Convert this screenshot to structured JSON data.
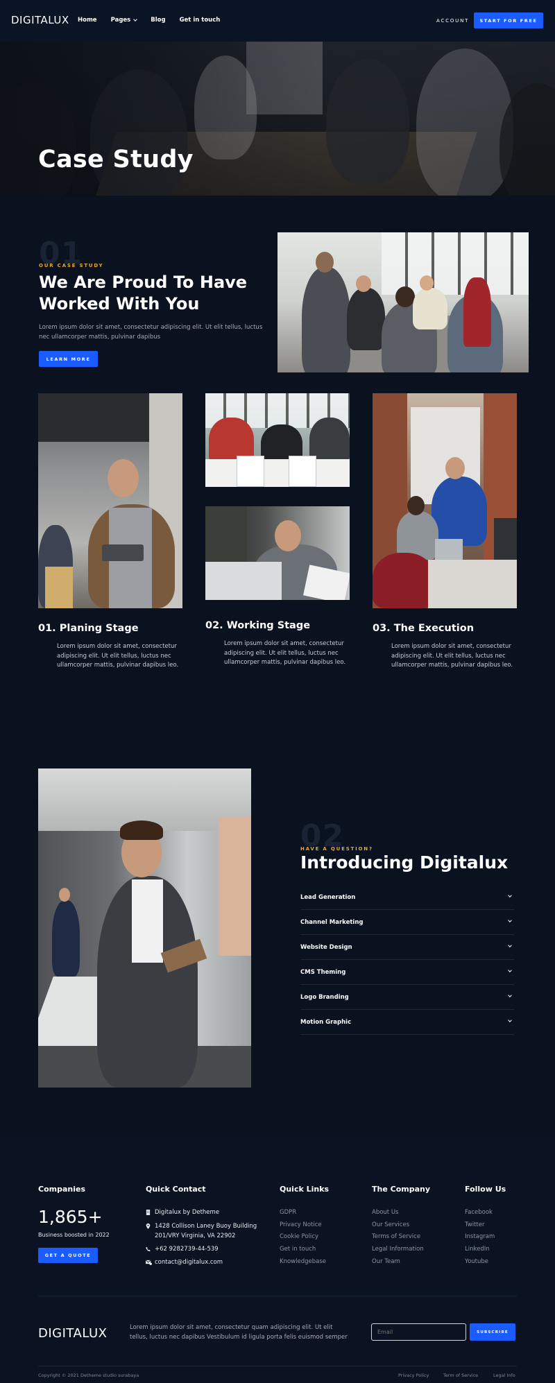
{
  "nav": {
    "logo": "DIGITALUX",
    "links": [
      {
        "label": "Home"
      },
      {
        "label": "Pages"
      },
      {
        "label": "Blog"
      },
      {
        "label": "Get in touch"
      }
    ],
    "account": "ACCOUNT",
    "cta": "START FOR FREE"
  },
  "hero": {
    "title": "Case Study"
  },
  "case_study": {
    "number": "01",
    "eyebrow": "OUR CASE STUDY",
    "title_line1": "We Are Proud To Have",
    "title_line2": "Worked With You",
    "text_line1": "Lorem ipsum dolor sit amet, consectetur adipiscing elit. Ut elit tellus, luctus",
    "text_line2": "nec ullamcorper mattis, pulvinar dapibus",
    "button": "LEARN MORE"
  },
  "stages": [
    {
      "title": "01. Planing Stage",
      "text": [
        "Lorem ipsum dolor sit amet, consectetur",
        "adipiscing elit. Ut elit tellus, luctus nec",
        "ullamcorper mattis, pulvinar dapibus leo."
      ]
    },
    {
      "title": "02. Working Stage",
      "text": [
        "Lorem ipsum dolor sit amet, consectetur",
        "adipiscing elit. Ut elit tellus, luctus nec",
        "ullamcorper mattis, pulvinar dapibus leo."
      ]
    },
    {
      "title": "03. The Execution",
      "text": [
        "Lorem ipsum dolor sit amet, consectetur",
        "adipiscing elit. Ut elit tellus, luctus nec",
        "ullamcorper mattis, pulvinar dapibus leo."
      ]
    }
  ],
  "intro": {
    "number": "02",
    "eyebrow": "HAVE A QUESTION?",
    "title": "Introducing Digitalux",
    "accordion": [
      {
        "label": "Lead Generation"
      },
      {
        "label": "Channel Marketing"
      },
      {
        "label": "Website Design"
      },
      {
        "label": "CMS Theming"
      },
      {
        "label": "Logo Branding"
      },
      {
        "label": "Motion Graphic"
      }
    ]
  },
  "footer": {
    "companies": {
      "heading": "Companies",
      "count": "1,865+",
      "caption": "Business boosted in 2022",
      "button": "GET A QUOTE"
    },
    "contact": {
      "heading": "Quick Contact",
      "company": "Digitalux by Detheme",
      "address_line1": "1428 Collison Laney Buoy Building",
      "address_line2": "201/VRY Virginia, VA 22902",
      "phone": "+62 9282739-44-539",
      "email": "contact@digitalux.com"
    },
    "quick_links": {
      "heading": "Quick Links",
      "items": [
        "GDPR",
        "Privacy Notice",
        "Cookie Policy",
        "Get in touch",
        "Knowledgebase"
      ]
    },
    "company_links": {
      "heading": "The Company",
      "items": [
        "About Us",
        "Our Services",
        "Terms of Service",
        "Legal Information",
        "Our Team"
      ]
    },
    "follow": {
      "heading": "Follow Us",
      "items": [
        "Facebook",
        "Twitter",
        "Instagram",
        "LinkedIn",
        "Youtube"
      ]
    },
    "brand": {
      "logo": "DIGITALUX",
      "text_line1": "Lorem ipsum dolor sit amet, consectetur quam adipiscing elit. Ut elit",
      "text_line2": "tellus, luctus nec dapibus Vestibulum id ligula porta felis euismod semper"
    },
    "newsletter": {
      "placeholder": "Email",
      "button": "SUBSCRIBE"
    },
    "copyright": "Copyright © 2021 Detheme studio surabaya",
    "legal": [
      "Privacy Policy",
      "Term of Service",
      "Legal Info"
    ]
  },
  "colors": {
    "background": "#0a111f",
    "accent": "#1a5cff",
    "eyebrow": "#e3a92f"
  }
}
